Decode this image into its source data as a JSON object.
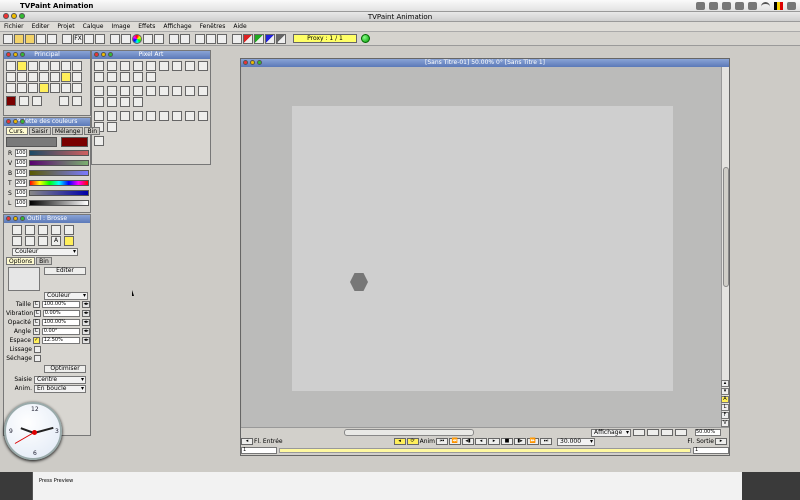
{
  "system": {
    "app_name": "TVPaint Animation",
    "apple": ""
  },
  "window": {
    "title": "TVPaint Animation"
  },
  "menu": [
    "Fichier",
    "Editer",
    "Projet",
    "Calque",
    "Image",
    "Effets",
    "Affichage",
    "Fenêtres",
    "Aide"
  ],
  "toolbar": {
    "fx_label": "FX",
    "proxy_label": "Proxy : 1 / 1"
  },
  "principal": {
    "title": "Principal"
  },
  "pixel_art": {
    "title": "Pixel Art"
  },
  "palette": {
    "title": "Palette des couleurs",
    "tabs": [
      "Curs.",
      "Saisir",
      "Mélange",
      "Bin"
    ],
    "sliders": [
      {
        "label": "R",
        "value": "100"
      },
      {
        "label": "V",
        "value": "100"
      },
      {
        "label": "B",
        "value": "100"
      },
      {
        "label": "T",
        "value": "209"
      },
      {
        "label": "S",
        "value": "100"
      },
      {
        "label": "L",
        "value": "100"
      }
    ],
    "swatch_color": "#7a0000"
  },
  "brush": {
    "title": "Outil : Brosse",
    "mode_select": "Couleur",
    "tabs": [
      "Options",
      "Bin"
    ],
    "edit_button": "Editer",
    "color_select": "Couleur",
    "params": [
      {
        "label": "Taille",
        "value": "100.00%"
      },
      {
        "label": "Vibration",
        "value": "0.00%"
      },
      {
        "label": "Opacité",
        "value": "100.00%"
      },
      {
        "label": "Angle",
        "value": "0.00°"
      },
      {
        "label": "Espace",
        "value": "12.50%"
      }
    ],
    "lissage": "Lissage",
    "sechage": "Séchage",
    "optimize_button": "Optimiser",
    "saisie_label": "Saisie",
    "saisie_value": "Centre",
    "anim_label": "Anim.",
    "anim_value": "En boucle"
  },
  "document": {
    "title": "[Sans Titre-01]  50.00%  0°  [Sans Titre 1]",
    "affichage": "Affichage",
    "zoom": "50.00%",
    "fl_entree": "Fl. Entrée",
    "fl_sortie": "Fl. Sortie",
    "anim_btn": "Anim",
    "fps": "30.000",
    "frame_in": "1",
    "frame_out": "1",
    "side_buttons": [
      "A",
      "L",
      "F",
      "V"
    ]
  },
  "clock": {
    "numbers": [
      "12",
      "3",
      "6",
      "9"
    ]
  },
  "underlay": {
    "label": "Press Preview"
  }
}
